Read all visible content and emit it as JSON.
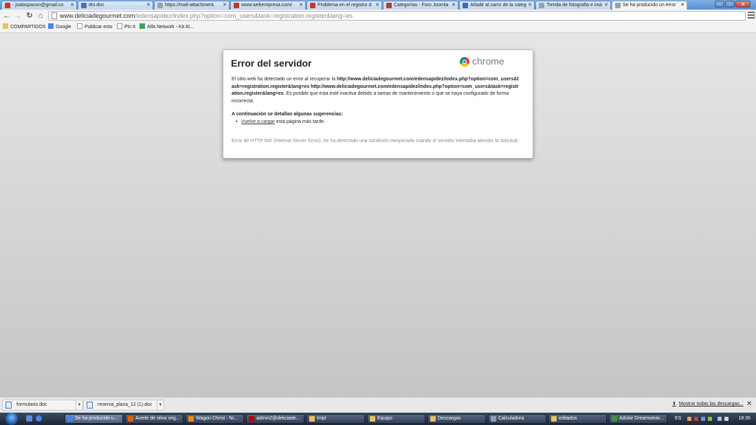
{
  "tabs": [
    {
      "label": "- jsalaspavon@gmail.co",
      "icon": "gmail-icon",
      "color": "#d93025",
      "active": false
    },
    {
      "label": "dni.doc",
      "icon": "document-icon",
      "color": "#4a72b0",
      "active": false
    },
    {
      "label": "https://mail-attachment.",
      "icon": "page-icon",
      "color": "#9aa0a6",
      "active": false
    },
    {
      "label": "www.webempresa.com/",
      "icon": "webempresa-icon",
      "color": "#c0392b",
      "active": false
    },
    {
      "label": "Problema en el registro d",
      "icon": "webempresa-icon",
      "color": "#c0392b",
      "active": false
    },
    {
      "label": "Categorías - Foro Joomla",
      "icon": "webempresa-icon",
      "color": "#c0392b",
      "active": false
    },
    {
      "label": "Añadir al carro de la categ",
      "icon": "joomla-icon",
      "color": "#3b6bb5",
      "active": false
    },
    {
      "label": "Tienda de fotografia e imá",
      "icon": "page-icon",
      "color": "#9aa0a6",
      "active": false
    },
    {
      "label": "Se ha producido un error",
      "icon": "page-icon",
      "color": "#9aa0a6",
      "active": true
    }
  ],
  "toolbar": {
    "url_domain": "www.deliciadegourmet.com",
    "url_path": "/edensapidez/index.php?option=com_users&task=registration.register&lang=es"
  },
  "bookmarks": [
    {
      "label": "COMPARTIDOS",
      "icon": "folder-icon"
    },
    {
      "label": "Google",
      "icon": "google-icon"
    },
    {
      "label": "Publicar esto",
      "icon": "page-icon"
    },
    {
      "label": "Pin It",
      "icon": "page-icon"
    },
    {
      "label": "Alfa Network - Kit Al...",
      "icon": "alfa-icon"
    }
  ],
  "error": {
    "title": "Error del servidor",
    "brand": "chrome",
    "intro": "El sitio web ha detectado un error al recuperar la",
    "url1": "http://www.deliciadegourmet.com/edensapidez/index.php?option=com_users&task=registration.register&lang=es",
    "url2": "http://www.deliciadegourmet.com/edensapidez/index.php?option=com_users&task=registration.register&lang=es",
    "intro_rest": ". Es posible que esta esté inactiva debido a tareas de mantenimiento o que se haya configurado de forma incorrecta.",
    "suggestions_title": "A continuación se detallan algunas sugerencias:",
    "reload_link": "Vuelve a cargar",
    "reload_rest": " esta página más tarde.",
    "detail": "Error de HTTP 500 (Internal Server Error): Se ha detectado una condición inesperada cuando el servidor intentaba atender la solicitud."
  },
  "downloads": {
    "items": [
      "formulario.doc",
      "reserva_plaza_12 (1).doc"
    ],
    "show_all": "Mostrar todas las descargas...",
    "close": "✕"
  },
  "taskbar": {
    "tasks": [
      {
        "label": "Se ha producido u...",
        "icon": "chrome-icon",
        "color": "#4285f4",
        "active": true
      },
      {
        "label": "Aceite de oliva virg...",
        "icon": "firefox-icon",
        "color": "#e66000",
        "active": false
      },
      {
        "label": "Wagon Christ - Ni...",
        "icon": "vlc-icon",
        "color": "#f08a00",
        "active": false
      },
      {
        "label": "admin2@deliciade...",
        "icon": "filezilla-icon",
        "color": "#bf0000",
        "active": false
      },
      {
        "label": "tmpl",
        "icon": "folder-icon",
        "color": "#e8c35a",
        "active": false
      },
      {
        "label": "Equipo",
        "icon": "folder-icon",
        "color": "#e8c35a",
        "active": false
      },
      {
        "label": "Descargas",
        "icon": "folder-icon",
        "color": "#e8c35a",
        "active": false
      },
      {
        "label": "Calculadora",
        "icon": "calculator-icon",
        "color": "#8aa0b8",
        "active": false
      },
      {
        "label": "editados",
        "icon": "folder-icon",
        "color": "#e8c35a",
        "active": false
      },
      {
        "label": "Adobe Dreamweav...",
        "icon": "dreamweaver-icon",
        "color": "#3f8f3f",
        "active": false
      }
    ],
    "lang": "ES",
    "clock": "18:35"
  }
}
